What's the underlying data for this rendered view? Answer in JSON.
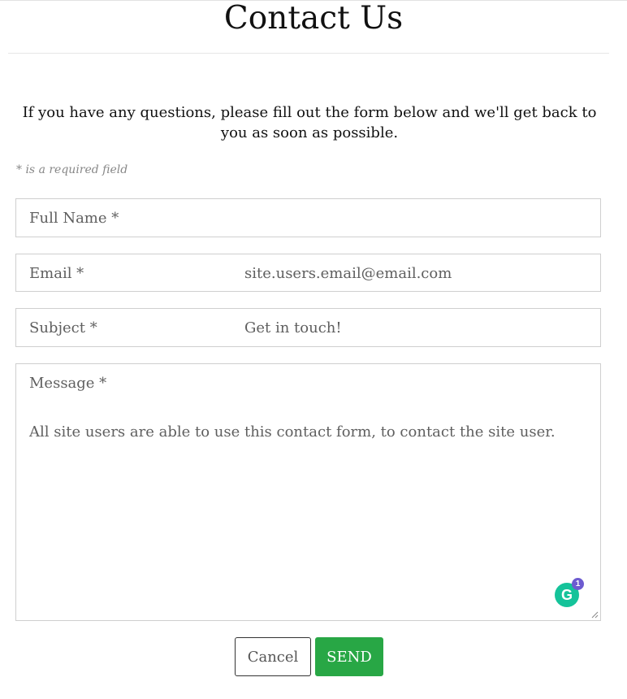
{
  "page": {
    "title": "Contact Us",
    "intro": "If you have any questions, please fill out the form below and we'll get back to you as soon as possible.",
    "required_note": "* is a required field"
  },
  "form": {
    "full_name": {
      "label": "Full Name *",
      "value": ""
    },
    "email": {
      "label": "Email *",
      "value": "site.users.email@email.com"
    },
    "subject": {
      "label": "Subject *",
      "value": "Get in touch!"
    },
    "message": {
      "label": "Message *",
      "value": "All site users are able to use this contact form, to contact the site user."
    }
  },
  "grammarly": {
    "count": "1",
    "letter": "G"
  },
  "buttons": {
    "cancel": "Cancel",
    "send": "SEND"
  },
  "colors": {
    "send_bg": "#28a745",
    "grammarly": "#15c39a",
    "badge": "#6d5bd0"
  }
}
